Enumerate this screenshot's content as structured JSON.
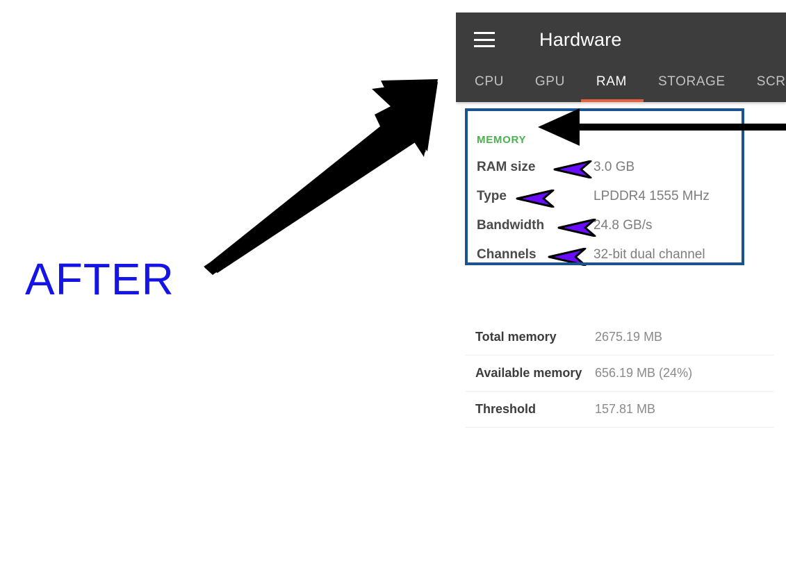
{
  "annotations": {
    "after_label": "AFTER",
    "after_color": "#1414e6",
    "big_arrow_color": "#000000",
    "memory_arrow_color": "#000000",
    "highlight_box_color": "#1a5490",
    "pointer_color": "#6a0dff"
  },
  "app": {
    "title": "Hardware",
    "menu_icon": "hamburger-icon",
    "appbar_color": "#3d3d3d",
    "accent_color": "#e8603c",
    "tabs": [
      {
        "label": "CPU",
        "active": false
      },
      {
        "label": "GPU",
        "active": false
      },
      {
        "label": "RAM",
        "active": true
      },
      {
        "label": "STORAGE",
        "active": false
      },
      {
        "label": "SCREE",
        "active": false
      }
    ]
  },
  "memory_card": {
    "title": "MEMORY",
    "title_color": "#4caf50",
    "rows": [
      {
        "label": "RAM size",
        "value": "3.0 GB"
      },
      {
        "label": "Type",
        "value": "LPDDR4 1555 MHz"
      },
      {
        "label": "Bandwidth",
        "value": "24.8 GB/s"
      },
      {
        "label": "Channels",
        "value": "32-bit dual channel"
      }
    ]
  },
  "stats": {
    "rows": [
      {
        "label": "Total memory",
        "value": "2675.19 MB"
      },
      {
        "label": "Available memory",
        "value": "656.19 MB (24%)"
      },
      {
        "label": "Threshold",
        "value": "157.81 MB"
      }
    ]
  }
}
